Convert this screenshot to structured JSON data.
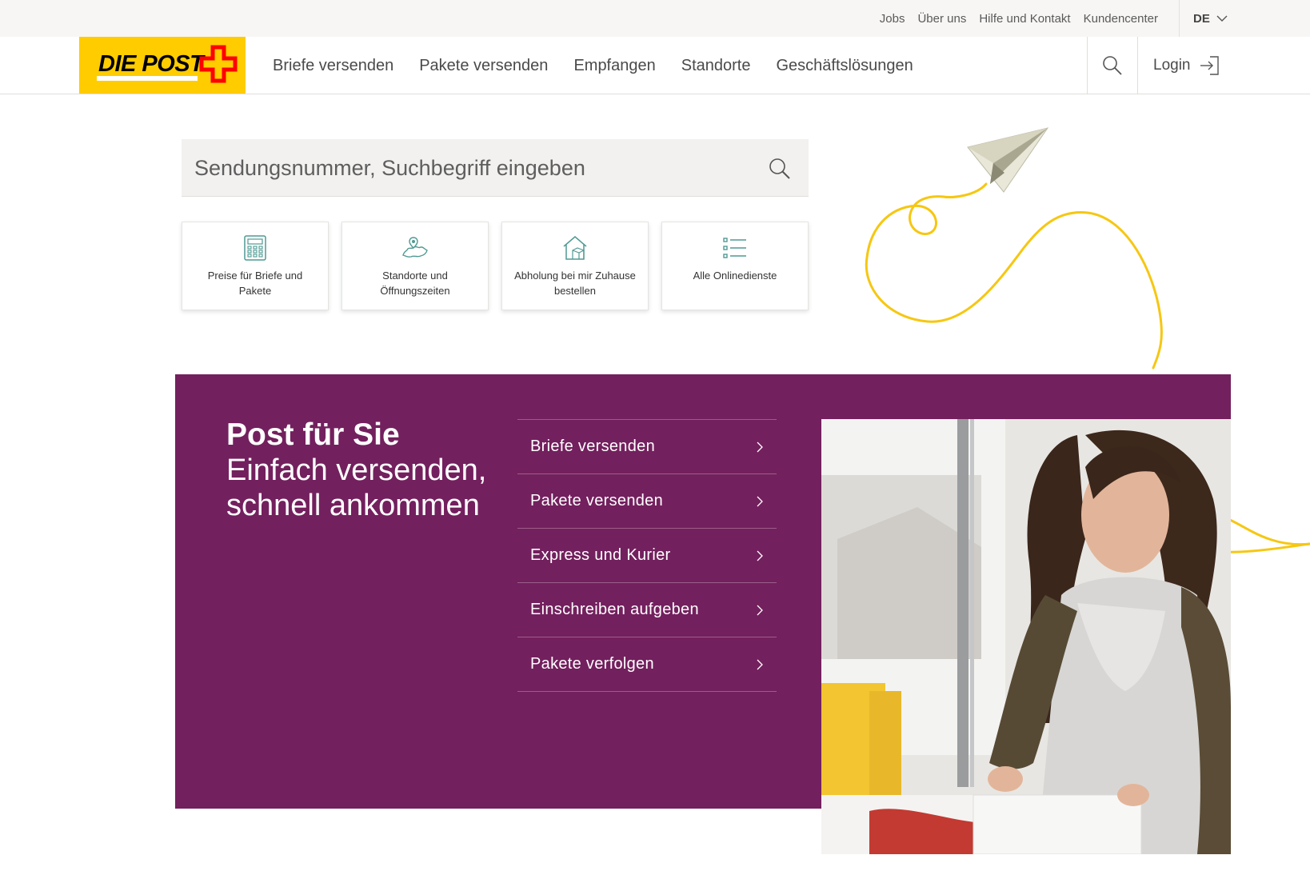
{
  "meta_nav": {
    "links": [
      "Jobs",
      "Über uns",
      "Hilfe und Kontakt",
      "Kundencenter"
    ],
    "language": "DE"
  },
  "header": {
    "logo_text": "DIE POST",
    "nav": [
      "Briefe versenden",
      "Pakete versenden",
      "Empfangen",
      "Standorte",
      "Geschäftslösungen"
    ],
    "login_label": "Login"
  },
  "search": {
    "placeholder": "Sendungsnummer, Suchbegriff eingeben"
  },
  "tiles": [
    {
      "label": "Preise für Briefe und Pakete",
      "icon": "calculator-icon"
    },
    {
      "label": "Standorte und Öffnungszeiten",
      "icon": "map-location-icon"
    },
    {
      "label": "Abholung bei mir Zuhause bestellen",
      "icon": "house-pickup-icon"
    },
    {
      "label": "Alle Onlinedienste",
      "icon": "list-icon"
    }
  ],
  "hero": {
    "title": "Post für Sie",
    "subtitle": "Einfach versenden, schnell ankommen",
    "links": [
      "Briefe versenden",
      "Pakete versenden",
      "Express und Kurier",
      "Einschreiben aufgeben",
      "Pakete verfolgen"
    ]
  },
  "colors": {
    "brand_yellow": "#ffcc00",
    "brand_red": "#ff0000",
    "hero_purple": "#73205e",
    "icon_teal": "#4f9a93"
  }
}
